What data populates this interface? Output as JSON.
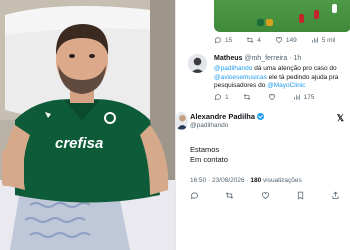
{
  "photo": {
    "jersey_brand": "crefisa",
    "jersey_color": "#0e5b3a",
    "pillow_color": "#ededed"
  },
  "previous_tweet": {
    "replies": "15",
    "retweets": "4",
    "likes": "149",
    "views": "5 mil"
  },
  "reply": {
    "name": "Matheus",
    "handle": "@mh_ferreira",
    "time": "1h",
    "text_parts": [
      {
        "t": "@padilhando",
        "mention": true
      },
      {
        "t": " dá uma atenção pro caso do ",
        "mention": false
      },
      {
        "t": "@avioesemusicas",
        "mention": true
      },
      {
        "t": " ele tá pedindo ajuda pra pesquisadores do ",
        "mention": false
      },
      {
        "t": "@MayoClinic",
        "mention": true
      }
    ],
    "replies": "1",
    "retweets": "",
    "likes": "175",
    "views": ""
  },
  "main_tweet": {
    "name": "Alexandre Padilha",
    "handle": "@padilhando",
    "text_line1": "Estamos",
    "text_line2": "Em contato",
    "timestamp": "16:50 · 23/08/2026 ·",
    "views_count": "180",
    "views_label": "visualizações"
  },
  "colors": {
    "accent": "#1d9bf0",
    "text": "#0f1419",
    "muted": "#536471"
  }
}
